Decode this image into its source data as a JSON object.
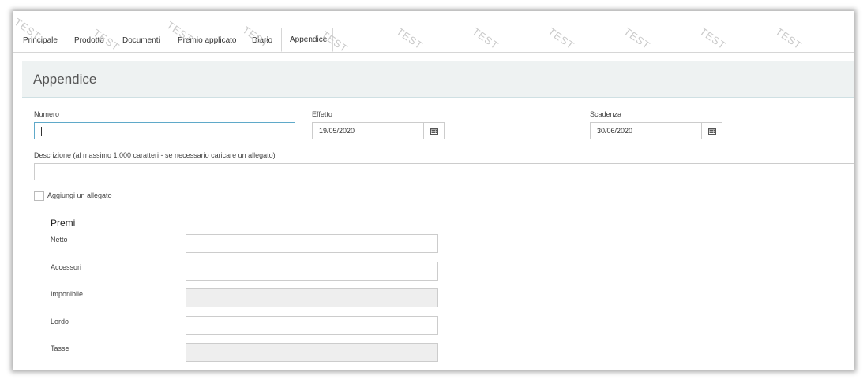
{
  "tabs": [
    {
      "label": "Principale"
    },
    {
      "label": "Prodotto"
    },
    {
      "label": "Documenti"
    },
    {
      "label": "Premio applicato"
    },
    {
      "label": "Diario"
    },
    {
      "label": "Appendice",
      "active": true
    }
  ],
  "watermark": "TEST",
  "section": {
    "title": "Appendice"
  },
  "form": {
    "numero": {
      "label": "Numero",
      "value": ""
    },
    "effetto": {
      "label": "Effetto",
      "value": "19/05/2020",
      "icon": "calendar-icon"
    },
    "scadenza": {
      "label": "Scadenza",
      "value": "30/06/2020",
      "icon": "calendar-icon"
    },
    "descrizione": {
      "label": "Descrizione (al massimo 1.000 caratteri - se necessario caricare un allegato)",
      "value": ""
    },
    "allegato": {
      "label": "Aggiungi un allegato",
      "checked": false
    }
  },
  "premi": {
    "title": "Premi",
    "rows": [
      {
        "label": "Netto",
        "value": "",
        "disabled": false
      },
      {
        "label": "Accessori",
        "value": "",
        "disabled": false
      },
      {
        "label": "Imponibile",
        "value": "",
        "disabled": true
      },
      {
        "label": "Lordo",
        "value": "",
        "disabled": false
      },
      {
        "label": "Tasse",
        "value": "",
        "disabled": true
      }
    ]
  }
}
